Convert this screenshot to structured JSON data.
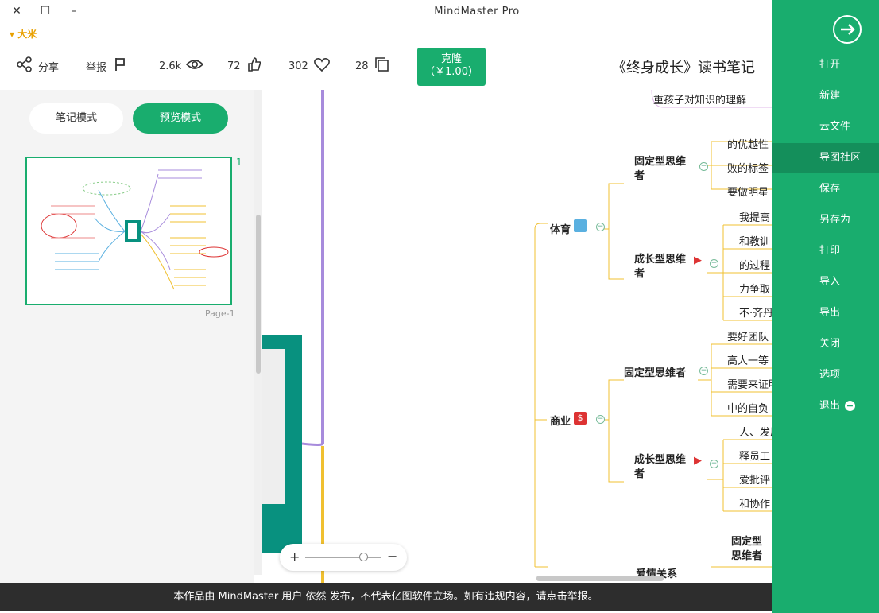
{
  "window": {
    "title": "MindMaster Pro",
    "close": "✕",
    "maximize": "☐",
    "minimize": "–",
    "user": "▾ 大米"
  },
  "toolbar": {
    "doc_title": "《终身成长》读书笔记",
    "buy_label": "克隆",
    "buy_price": "（￥1.00）",
    "copies": "28",
    "likes_heart": "302",
    "thumbs": "72",
    "views": "2.6k",
    "report": "举报",
    "share": "分享"
  },
  "left_panel": {
    "mode_preview": "预览模式",
    "mode_note": "笔记模式",
    "page_number": "1",
    "page_caption": "Page-1"
  },
  "canvas": {
    "top_partial": "重孩子对知识的理解",
    "branch_sports": "体育",
    "branch_business": "商业",
    "branch_relation": "爱情关系",
    "fixed_mind": "固定型思维者",
    "growth_mind": "成长型思维者",
    "sports_fixed": [
      "的优越性",
      "败的标签",
      "要做明星"
    ],
    "sports_growth": [
      "我提高",
      "和教训",
      "的过程",
      "力争取",
      "不·齐丹"
    ],
    "business_fixed": [
      "要好团队",
      "高人一等",
      "需要来证明",
      "中的自负"
    ],
    "business_growth": [
      "人、发展",
      "释员工",
      "爱批评",
      "和协作"
    ],
    "relation_fixed": "固定型思维者"
  },
  "notice": "本作品由 MindMaster 用户 依然 发布，不代表亿图软件立场。如有违规内容，请点击举报。",
  "menu": {
    "items": [
      "打开",
      "新建",
      "云文件",
      "导图社区",
      "保存",
      "另存为",
      "打印",
      "导入",
      "导出",
      "关闭",
      "选项",
      "退出"
    ],
    "active": "导图社区"
  },
  "colors": {
    "brand": "#19ad6e",
    "purple_branch": "#a78bdc",
    "yellow_branch": "#f0c030",
    "teal_card": "#08917f"
  }
}
